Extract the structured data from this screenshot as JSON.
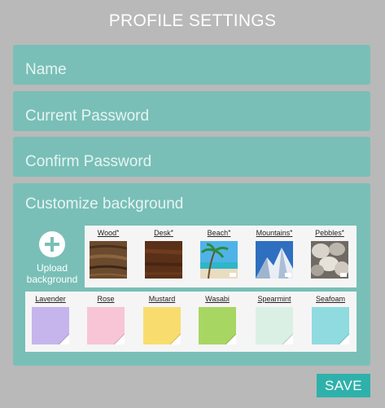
{
  "page": {
    "title": "PROFILE SETTINGS"
  },
  "form": {
    "name_placeholder": "Name",
    "current_password_placeholder": "Current Password",
    "confirm_password_placeholder": "Confirm Password"
  },
  "background": {
    "heading": "Customize background",
    "upload_label": "Upload background",
    "upload_icon": "plus-circle-icon",
    "photo_options": [
      {
        "label": "Wood",
        "premium": "*",
        "kind": "wood"
      },
      {
        "label": "Desk",
        "premium": "*",
        "kind": "desk"
      },
      {
        "label": "Beach",
        "premium": "*",
        "kind": "beach"
      },
      {
        "label": "Mountains",
        "premium": "*",
        "kind": "mountains"
      },
      {
        "label": "Pebbles",
        "premium": "*",
        "kind": "pebbles"
      }
    ],
    "color_options": [
      {
        "label": "Lavender",
        "color": "#c6b5ec"
      },
      {
        "label": "Rose",
        "color": "#f7c5d6"
      },
      {
        "label": "Mustard",
        "color": "#f8dd6e"
      },
      {
        "label": "Wasabi",
        "color": "#a8d662"
      },
      {
        "label": "Spearmint",
        "color": "#dbf0e4"
      },
      {
        "label": "Seafoam",
        "color": "#8fdbe0"
      }
    ]
  },
  "actions": {
    "save_label": "SAVE"
  },
  "colors": {
    "page_bg": "#b9b9b9",
    "panel": "#79bfb7",
    "accent": "#2fb1ab"
  }
}
